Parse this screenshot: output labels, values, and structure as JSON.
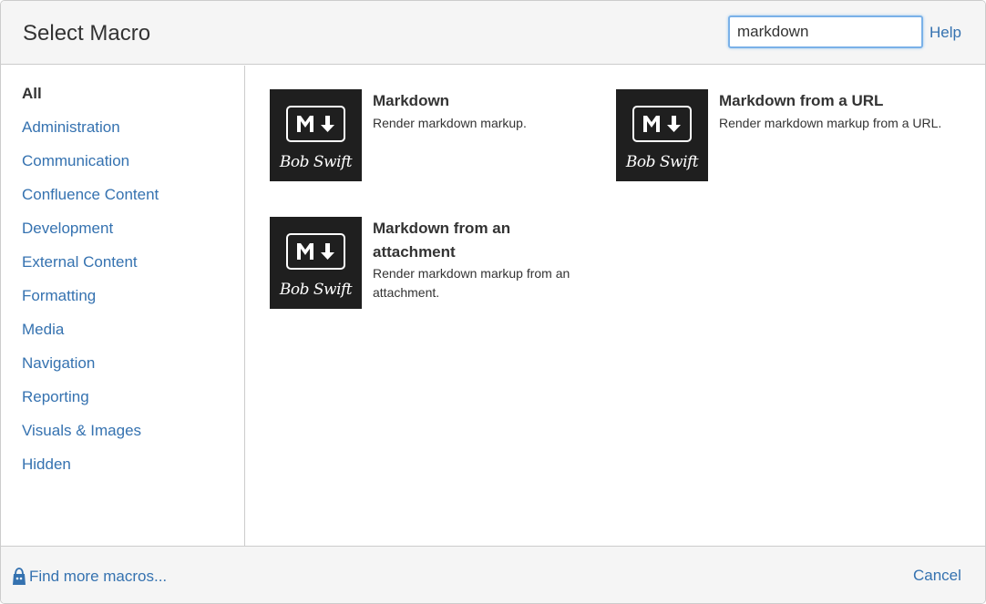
{
  "dialog": {
    "title": "Select Macro",
    "help_label": "Help"
  },
  "search": {
    "value": "markdown",
    "placeholder": ""
  },
  "categories": [
    {
      "label": "All",
      "active": true
    },
    {
      "label": "Administration"
    },
    {
      "label": "Communication"
    },
    {
      "label": "Confluence Content"
    },
    {
      "label": "Development"
    },
    {
      "label": "External Content"
    },
    {
      "label": "Formatting"
    },
    {
      "label": "Media"
    },
    {
      "label": "Navigation"
    },
    {
      "label": "Reporting"
    },
    {
      "label": "Visuals & Images"
    },
    {
      "label": "Hidden"
    }
  ],
  "macros": [
    {
      "name": "Markdown",
      "description": "Render markdown markup.",
      "icon": "markdown-icon",
      "icon_brand": "Bob Swift"
    },
    {
      "name": "Markdown from a URL",
      "description": "Render markdown markup from a URL.",
      "icon": "markdown-icon",
      "icon_brand": "Bob Swift"
    },
    {
      "name": "Markdown from an attachment",
      "description": "Render markdown markup from an attachment.",
      "icon": "markdown-icon",
      "icon_brand": "Bob Swift"
    }
  ],
  "footer": {
    "find_more_label": "Find more macros...",
    "cancel_label": "Cancel"
  },
  "colors": {
    "link": "#3572b0",
    "header_bg": "#f5f5f5",
    "icon_bg": "#1f1f1f"
  }
}
